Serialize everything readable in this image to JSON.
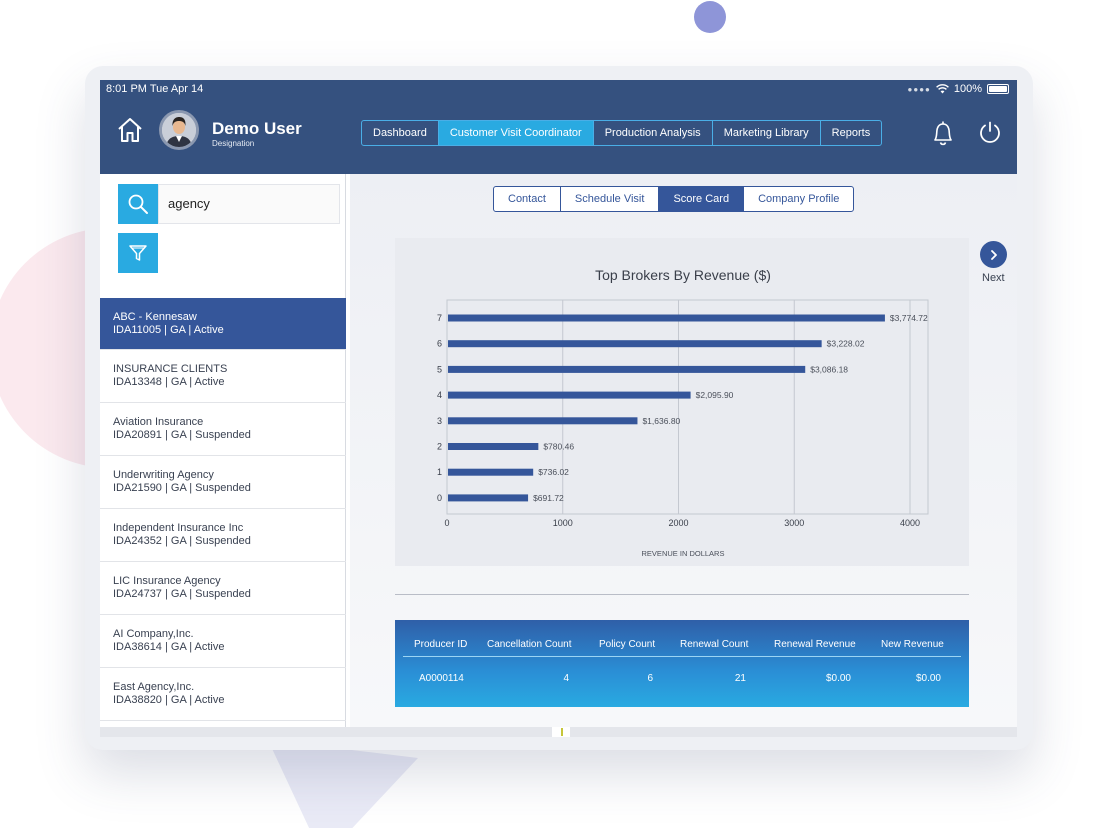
{
  "status_bar": {
    "time": "8:01 PM  Tue Apr 14",
    "battery": "100%"
  },
  "user": {
    "name": "Demo User",
    "designation": "Designation"
  },
  "nav": {
    "tabs": [
      {
        "label": "Dashboard",
        "active": false
      },
      {
        "label": "Customer Visit Coordinator",
        "active": true
      },
      {
        "label": "Production Analysis",
        "active": false
      },
      {
        "label": "Marketing Library",
        "active": false
      },
      {
        "label": "Reports",
        "active": false
      }
    ]
  },
  "search": {
    "value": "agency"
  },
  "customers": [
    {
      "name": "ABC - Kennesaw",
      "detail": "IDA11005 | GA | Active",
      "selected": true
    },
    {
      "name": "INSURANCE CLIENTS",
      "detail": "IDA13348 | GA | Active",
      "selected": false
    },
    {
      "name": "Aviation Insurance",
      "detail": "IDA20891 | GA | Suspended",
      "selected": false
    },
    {
      "name": "Underwriting Agency",
      "detail": "IDA21590 | GA | Suspended",
      "selected": false
    },
    {
      "name": "Independent Insurance Inc",
      "detail": "IDA24352 | GA | Suspended",
      "selected": false
    },
    {
      "name": "LIC Insurance Agency",
      "detail": "IDA24737 | GA | Suspended",
      "selected": false
    },
    {
      "name": "AI Company,Inc.",
      "detail": "IDA38614 | GA | Active",
      "selected": false
    },
    {
      "name": "East Agency,Inc.",
      "detail": "IDA38820 | GA | Active",
      "selected": false
    }
  ],
  "subtabs": [
    {
      "label": "Contact",
      "active": false
    },
    {
      "label": "Schedule Visit",
      "active": false
    },
    {
      "label": "Score Card",
      "active": true
    },
    {
      "label": "Company Profile",
      "active": false
    }
  ],
  "next": {
    "label": "Next"
  },
  "chart_data": {
    "type": "bar",
    "orientation": "horizontal",
    "title": "Top Brokers By Revenue ($)",
    "xlabel": "REVENUE IN DOLLARS",
    "ylabel": "",
    "categories": [
      "7",
      "6",
      "5",
      "4",
      "3",
      "2",
      "1",
      "0"
    ],
    "values": [
      3774.72,
      3228.02,
      3086.18,
      2095.9,
      1636.8,
      780.46,
      736.02,
      691.72
    ],
    "value_labels": [
      "$3,774.72",
      "$3,228.02",
      "$3,086.18",
      "$2,095.90",
      "$1,636.80",
      "$780.46",
      "$736.02",
      "$691.72"
    ],
    "xlim": [
      0,
      4000
    ],
    "xticks": [
      "0",
      "1000",
      "2000",
      "3000",
      "4000"
    ],
    "grid": true,
    "bar_color": "#35569a"
  },
  "table": {
    "headers": [
      "Producer ID",
      "Cancellation Count",
      "Policy Count",
      "Renewal Count",
      "Renewal Revenue",
      "New Revenue"
    ],
    "rows": [
      [
        "A0000114",
        "4",
        "6",
        "21",
        "$0.00",
        "$0.00"
      ]
    ]
  },
  "colors": {
    "header": "#35517f",
    "accent": "#29aae1",
    "selected": "#35569a"
  }
}
